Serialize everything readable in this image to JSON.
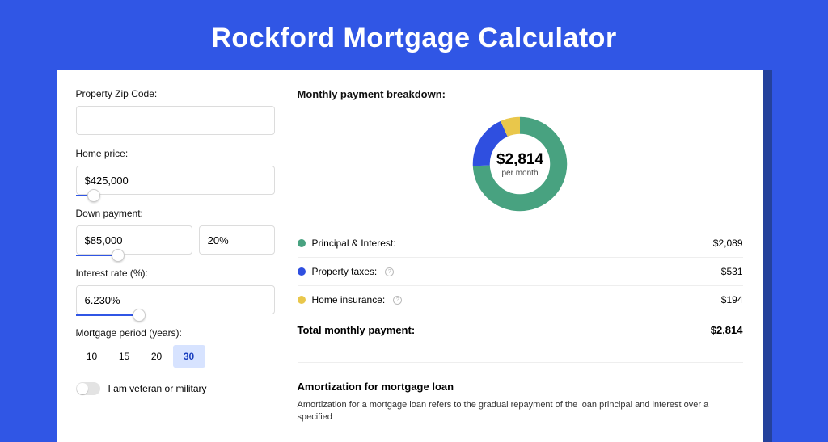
{
  "page": {
    "title": "Rockford Mortgage Calculator"
  },
  "form": {
    "zip_label": "Property Zip Code:",
    "zip_value": "",
    "home_price_label": "Home price:",
    "home_price_value": "$425,000",
    "down_payment_label": "Down payment:",
    "down_payment_value": "$85,000",
    "down_payment_pct": "20%",
    "interest_label": "Interest rate (%):",
    "interest_value": "6.230%",
    "period_label": "Mortgage period (years):",
    "periods": [
      "10",
      "15",
      "20",
      "30"
    ],
    "period_active_index": 3,
    "veteran_label": "I am veteran or military"
  },
  "breakdown": {
    "heading": "Monthly payment breakdown:",
    "amount": "$2,814",
    "amount_sub": "per month",
    "items": [
      {
        "color": "#48a280",
        "label": "Principal & Interest:",
        "value": "$2,089",
        "info": false
      },
      {
        "color": "#2f4fe0",
        "label": "Property taxes:",
        "value": "$531",
        "info": true
      },
      {
        "color": "#e9c74b",
        "label": "Home insurance:",
        "value": "$194",
        "info": true
      }
    ],
    "total_label": "Total monthly payment:",
    "total_value": "$2,814"
  },
  "amort": {
    "heading": "Amortization for mortgage loan",
    "text": "Amortization for a mortgage loan refers to the gradual repayment of the loan principal and interest over a specified"
  },
  "chart_data": {
    "type": "pie",
    "title": "Monthly payment breakdown",
    "series": [
      {
        "name": "Principal & Interest",
        "value": 2089,
        "color": "#48a280"
      },
      {
        "name": "Property taxes",
        "value": 531,
        "color": "#2f4fe0"
      },
      {
        "name": "Home insurance",
        "value": 194,
        "color": "#e9c74b"
      }
    ],
    "total": 2814,
    "unit": "USD/month"
  }
}
